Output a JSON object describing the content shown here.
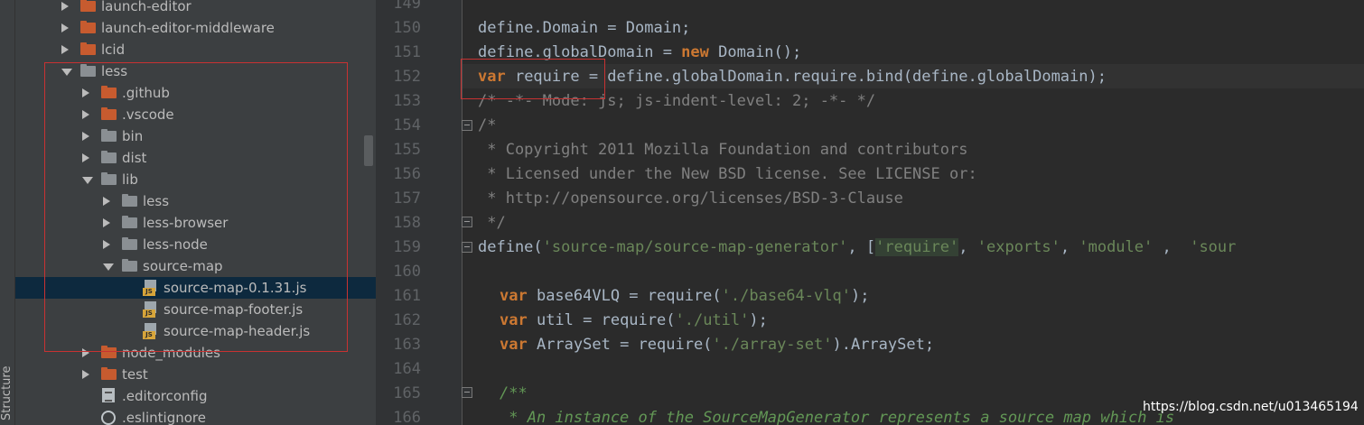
{
  "side_tab": {
    "label": "Structure"
  },
  "tree": {
    "rows": [
      {
        "label": "launch-editor",
        "icon": "folder-orange",
        "arrow": "right"
      },
      {
        "label": "launch-editor-middleware",
        "icon": "folder-orange",
        "arrow": "right"
      },
      {
        "label": "lcid",
        "icon": "folder-orange",
        "arrow": "right"
      },
      {
        "label": "less",
        "icon": "folder-gray",
        "arrow": "down"
      },
      {
        "label": ".github",
        "icon": "folder-orange",
        "arrow": "right"
      },
      {
        "label": ".vscode",
        "icon": "folder-orange",
        "arrow": "right"
      },
      {
        "label": "bin",
        "icon": "folder-gray",
        "arrow": "right"
      },
      {
        "label": "dist",
        "icon": "folder-gray",
        "arrow": "right"
      },
      {
        "label": "lib",
        "icon": "folder-gray",
        "arrow": "down"
      },
      {
        "label": "less",
        "icon": "folder-gray",
        "arrow": "right"
      },
      {
        "label": "less-browser",
        "icon": "folder-gray",
        "arrow": "right"
      },
      {
        "label": "less-node",
        "icon": "folder-gray",
        "arrow": "right"
      },
      {
        "label": "source-map",
        "icon": "folder-gray",
        "arrow": "down"
      },
      {
        "label": "source-map-0.1.31.js",
        "icon": "js-file",
        "selected": true
      },
      {
        "label": "source-map-footer.js",
        "icon": "js-file"
      },
      {
        "label": "source-map-header.js",
        "icon": "js-file"
      },
      {
        "label": "node_modules",
        "icon": "folder-orange",
        "arrow": "right"
      },
      {
        "label": "test",
        "icon": "folder-orange",
        "arrow": "right"
      },
      {
        "label": ".editorconfig",
        "icon": "config-file"
      },
      {
        "label": ".eslintignore",
        "icon": "ignore-file"
      }
    ]
  },
  "editor": {
    "line_numbers": [
      "149",
      "150",
      "151",
      "152",
      "153",
      "154",
      "155",
      "156",
      "157",
      "158",
      "159",
      "160",
      "161",
      "162",
      "163",
      "164",
      "165",
      "166"
    ],
    "lines": {
      "l150": {
        "a": "define.Domain = Domain;"
      },
      "l151": {
        "a": "define.globalDomain = ",
        "kw": "new",
        "b": " Domain();"
      },
      "l152": {
        "kw": "var",
        "a": " require = define.globalDomain.require.bind(define.globalDomain);"
      },
      "l153": {
        "cmt": "/* -*- Mode: js; js-indent-level: 2; -*- */"
      },
      "l154": {
        "cmt": "/*"
      },
      "l155": {
        "cmt": " * Copyright 2011 Mozilla Foundation and contributors"
      },
      "l156": {
        "cmt": " * Licensed under the New BSD license. See LICENSE or:"
      },
      "l157": {
        "cmt": " * http://opensource.org/licenses/BSD-3-Clause"
      },
      "l158": {
        "cmt": " */"
      },
      "l159": {
        "a": "define(",
        "s1": "'source-map/source-map-generator'",
        "b": ", [",
        "s2": "'require'",
        "c": ", ",
        "s3": "'exports'",
        "d": ", ",
        "s4": "'module'",
        "e": " ,  ",
        "s5": "'sour"
      },
      "l161": {
        "kw": "var",
        "a": " base64VLQ = require(",
        "s": "'./base64-vlq'",
        "b": ");"
      },
      "l162": {
        "kw": "var",
        "a": " util = require(",
        "s": "'./util'",
        "b": ");"
      },
      "l163": {
        "kw": "var",
        "a": " ArraySet = require(",
        "s": "'./array-set'",
        "b": ").ArraySet;"
      },
      "l165": {
        "doc": "/**"
      },
      "l166": {
        "doc": " * An instance of the SourceMapGenerator represents a source map which is"
      }
    }
  },
  "watermark": "https://blog.csdn.net/u013465194"
}
